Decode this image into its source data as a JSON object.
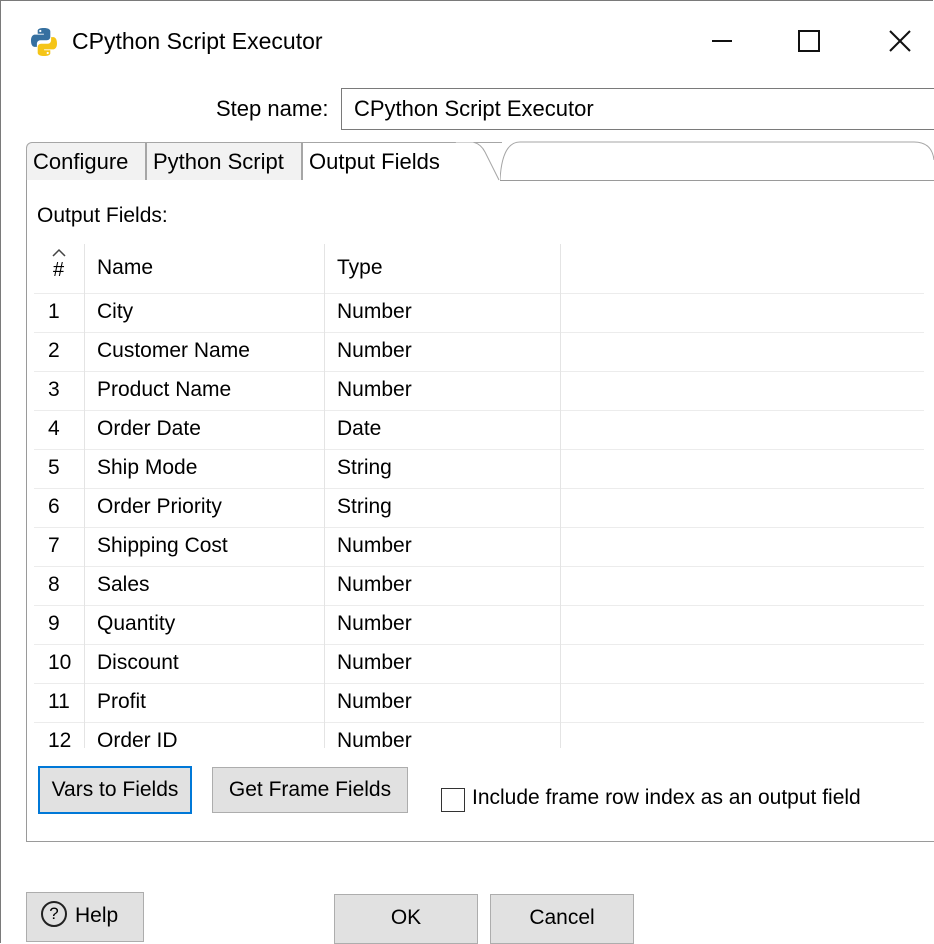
{
  "window": {
    "title": "CPython Script Executor",
    "icon": "python-logo-icon"
  },
  "step": {
    "label": "Step name:",
    "value": "CPython Script Executor"
  },
  "tabs": [
    {
      "label": "Configure",
      "active": false
    },
    {
      "label": "Python Script",
      "active": false
    },
    {
      "label": "Output Fields",
      "active": true
    }
  ],
  "output": {
    "section_label": "Output Fields:",
    "columns": {
      "num": "#",
      "name": "Name",
      "type": "Type"
    },
    "rows": [
      {
        "num": "1",
        "name": "City",
        "type": "Number"
      },
      {
        "num": "2",
        "name": "Customer Name",
        "type": "Number"
      },
      {
        "num": "3",
        "name": "Product Name",
        "type": "Number"
      },
      {
        "num": "4",
        "name": "Order Date",
        "type": "Date"
      },
      {
        "num": "5",
        "name": "Ship Mode",
        "type": "String"
      },
      {
        "num": "6",
        "name": "Order Priority",
        "type": "String"
      },
      {
        "num": "7",
        "name": "Shipping Cost",
        "type": "Number"
      },
      {
        "num": "8",
        "name": "Sales",
        "type": "Number"
      },
      {
        "num": "9",
        "name": "Quantity",
        "type": "Number"
      },
      {
        "num": "10",
        "name": "Discount",
        "type": "Number"
      },
      {
        "num": "11",
        "name": "Profit",
        "type": "Number"
      },
      {
        "num": "12",
        "name": "Order ID",
        "type": "Number"
      }
    ]
  },
  "buttons": {
    "vars_to_fields": "Vars to Fields",
    "get_frame_fields": "Get Frame Fields",
    "include_index_label": "Include frame row index as an output field",
    "include_index_checked": false,
    "help": "Help",
    "ok": "OK",
    "cancel": "Cancel"
  },
  "colors": {
    "focus_border": "#0078d7",
    "button_bg": "#e1e1e1"
  }
}
